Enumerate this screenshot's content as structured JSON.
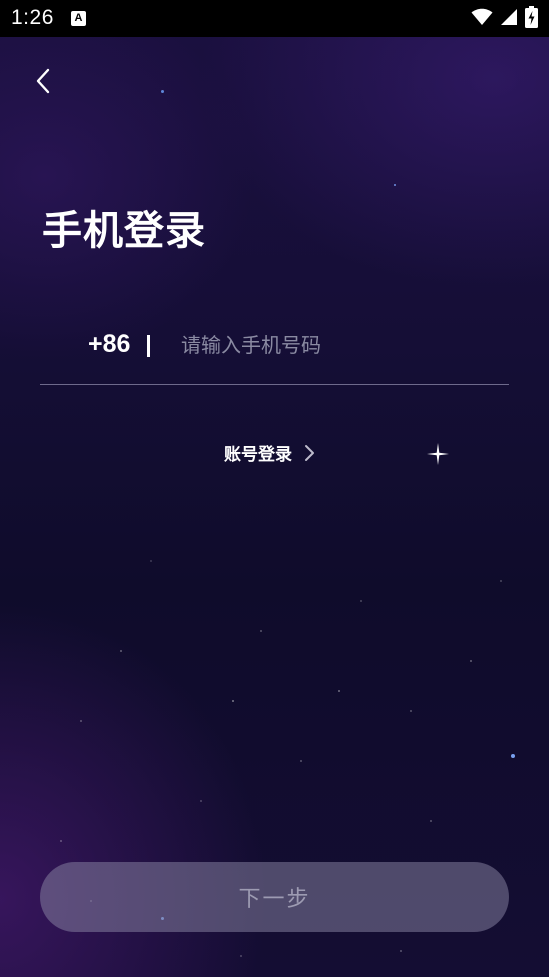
{
  "status_bar": {
    "time": "1:26",
    "notification_icon": "text-a-icon",
    "notification_glyph": "A",
    "icons": [
      "wifi-icon",
      "signal-icon",
      "battery-charging-icon"
    ]
  },
  "header": {
    "back_icon": "chevron-left-icon"
  },
  "main": {
    "title": "手机登录",
    "country_code": "+86",
    "phone_placeholder": "请输入手机号码",
    "phone_value": "",
    "account_login_label": "账号登录",
    "account_login_icon": "chevron-right-icon",
    "next_button_label": "下一步"
  },
  "colors": {
    "background_top": "#1b1040",
    "background_bottom": "#140d33",
    "text_primary": "#ffffff",
    "placeholder": "#8a8aa2",
    "underline": "#6e6a8c",
    "button_disabled_bg": "#6a6685",
    "button_disabled_text": "#9d9bb2"
  }
}
